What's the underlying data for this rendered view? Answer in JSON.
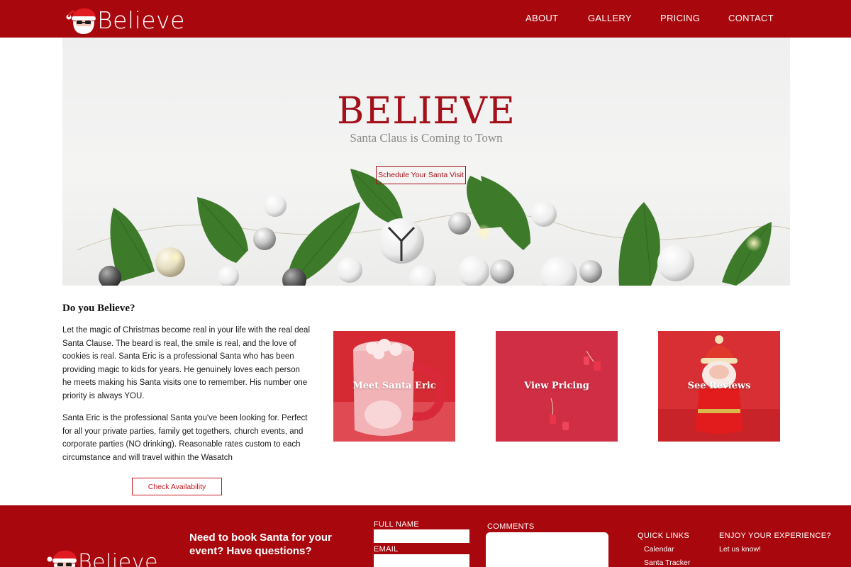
{
  "brand": {
    "name": "Believe"
  },
  "nav": {
    "items": [
      "ABOUT",
      "GALLERY",
      "PRICING",
      "CONTACT"
    ]
  },
  "hero": {
    "title": "BELIEVE",
    "subtitle": "Santa Claus is Coming to Town",
    "cta": "Schedule Your Santa Visit"
  },
  "intro": {
    "title": "Do you Believe?",
    "paragraph1": "Let the magic of Christmas become real in your life with the real deal Santa Clause. The beard is real, the smile is real, and the love of cookies is real.  Santa Eric is a professional Santa who has been providing magic to kids for years. He genuinely loves each person he meets making his Santa visits one to remember. His number one priority is always YOU.",
    "paragraph2": "Santa Eric is the professional Santa you've been looking for. Perfect for all your private parties, family get togethers, church events, and corporate parties (NO drinking). Reasonable rates custom to each circumstance and will travel within the Wasatch",
    "button": "Check Availability"
  },
  "cards": [
    {
      "label": "Meet Santa Eric"
    },
    {
      "label": "View Pricing"
    },
    {
      "label": "See Reviews"
    }
  ],
  "footer": {
    "cta": "Need to book Santa for your event? Have questions?",
    "full_name_label": "FULL NAME",
    "email_label": "EMAIL",
    "comments_label": "COMMENTS",
    "quick_links_title": "QUICK LINKS",
    "quick_links": [
      "Calendar",
      "Santa Tracker"
    ],
    "enjoy_title": "ENJOY YOUR EXPERIENCE?",
    "enjoy_text": "Let us know!"
  },
  "colors": {
    "brand_red": "#a8080d",
    "accent_red": "#a3101a",
    "card_red": "#c4202a"
  }
}
